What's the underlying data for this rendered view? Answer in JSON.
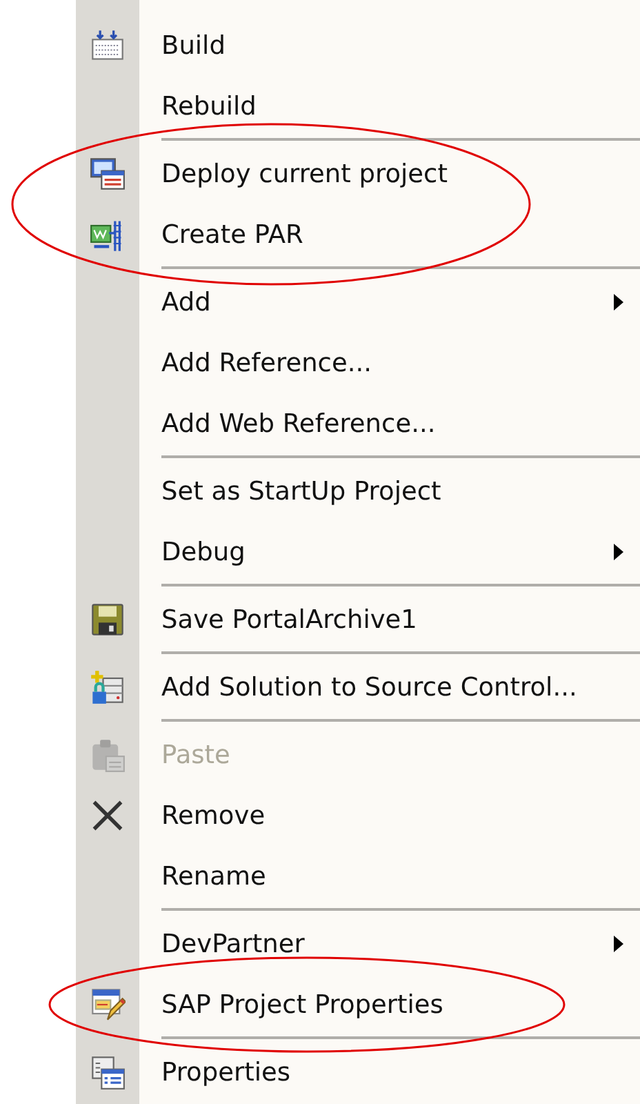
{
  "context_menu": {
    "groups": [
      {
        "items": [
          {
            "label": "Build",
            "disabled": false,
            "submenu": false,
            "circled": false
          },
          {
            "label": "Rebuild",
            "disabled": false,
            "submenu": false,
            "circled": false
          }
        ]
      },
      {
        "items": [
          {
            "label": "Deploy current project",
            "disabled": false,
            "submenu": false,
            "circled": true
          },
          {
            "label": "Create PAR",
            "disabled": false,
            "submenu": false,
            "circled": true
          }
        ]
      },
      {
        "items": [
          {
            "label": "Add",
            "disabled": false,
            "submenu": true,
            "circled": false
          },
          {
            "label": "Add Reference...",
            "disabled": false,
            "submenu": false,
            "circled": false
          },
          {
            "label": "Add Web Reference...",
            "disabled": false,
            "submenu": false,
            "circled": false
          }
        ]
      },
      {
        "items": [
          {
            "label": "Set as StartUp Project",
            "disabled": false,
            "submenu": false,
            "circled": false
          },
          {
            "label": "Debug",
            "disabled": false,
            "submenu": true,
            "circled": false
          }
        ]
      },
      {
        "items": [
          {
            "label": "Save PortalArchive1",
            "disabled": false,
            "submenu": false,
            "circled": false
          }
        ]
      },
      {
        "items": [
          {
            "label": "Add Solution to Source Control...",
            "disabled": false,
            "submenu": false,
            "circled": false
          }
        ]
      },
      {
        "items": [
          {
            "label": "Paste",
            "disabled": true,
            "submenu": false,
            "circled": false
          },
          {
            "label": "Remove",
            "disabled": false,
            "submenu": false,
            "circled": false
          },
          {
            "label": "Rename",
            "disabled": false,
            "submenu": false,
            "circled": false
          }
        ]
      },
      {
        "items": [
          {
            "label": "DevPartner",
            "disabled": false,
            "submenu": true,
            "circled": false
          },
          {
            "label": "SAP Project Properties",
            "disabled": false,
            "submenu": false,
            "circled": true
          }
        ]
      },
      {
        "items": [
          {
            "label": "Properties",
            "disabled": false,
            "submenu": false,
            "circled": false
          }
        ]
      }
    ]
  }
}
